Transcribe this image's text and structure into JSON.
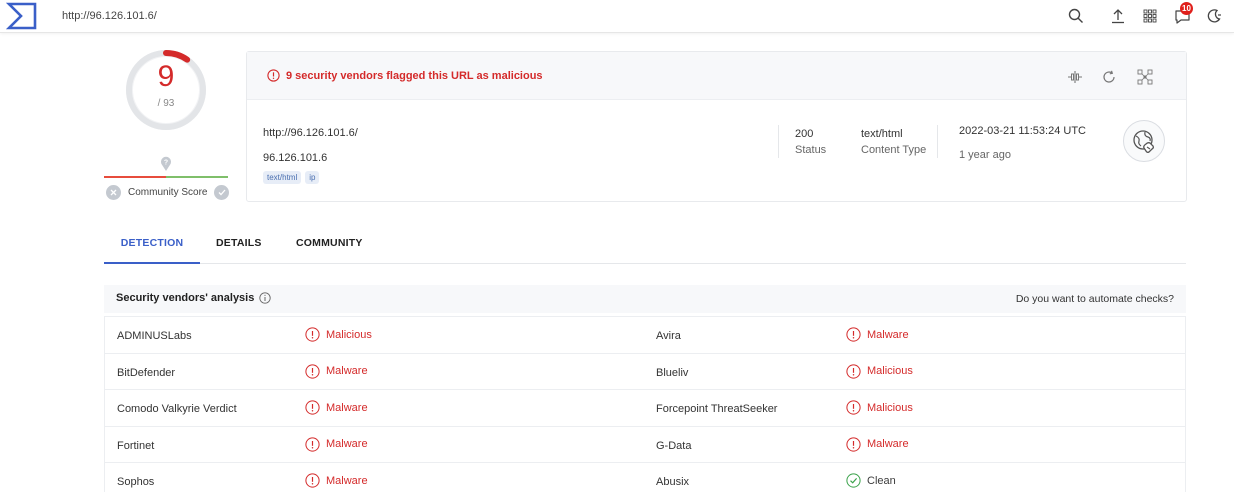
{
  "topbar": {
    "url": "http://96.126.101.6/",
    "icons": [
      "search-icon",
      "upload-icon",
      "apps-grid-icon",
      "notifications-icon",
      "dark-mode-icon"
    ],
    "notification_count": "10"
  },
  "score": {
    "detections": "9",
    "total": "/ 93",
    "fraction_flagged": 0.0968,
    "community_label": "Community Score"
  },
  "summary": {
    "alert": "9 security vendors flagged this URL as malicious",
    "url": "http://96.126.101.6/",
    "host": "96.126.101.6",
    "tags": [
      "text/html",
      "ip"
    ],
    "status_value": "200",
    "status_label": "Status",
    "content_type_value": "text/html",
    "content_type_label": "Content Type",
    "date": "2022-03-21 11:53:24 UTC",
    "ago": "1 year ago"
  },
  "tabs": [
    {
      "label": "DETECTION",
      "active": true
    },
    {
      "label": "DETAILS",
      "active": false
    },
    {
      "label": "COMMUNITY",
      "active": false
    }
  ],
  "vendors": {
    "title": "Security vendors' analysis",
    "automate_link": "Do you want to automate checks?",
    "rows": [
      {
        "left_name": "ADMINUSLabs",
        "left_result": "Malicious",
        "left_state": "bad",
        "right_name": "Avira",
        "right_result": "Malware",
        "right_state": "bad"
      },
      {
        "left_name": "BitDefender",
        "left_result": "Malware",
        "left_state": "bad",
        "right_name": "Blueliv",
        "right_result": "Malicious",
        "right_state": "bad"
      },
      {
        "left_name": "Comodo Valkyrie Verdict",
        "left_result": "Malware",
        "left_state": "bad",
        "right_name": "Forcepoint ThreatSeeker",
        "right_result": "Malicious",
        "right_state": "bad"
      },
      {
        "left_name": "Fortinet",
        "left_result": "Malware",
        "left_state": "bad",
        "right_name": "G-Data",
        "right_result": "Malware",
        "right_state": "bad"
      },
      {
        "left_name": "Sophos",
        "left_result": "Malware",
        "left_state": "bad",
        "right_name": "Abusix",
        "right_result": "Clean",
        "right_state": "ok"
      }
    ]
  },
  "colors": {
    "malicious": "#d42a2a",
    "accent": "#3a5fc8",
    "clean": "#3aa24a",
    "logo": "#3a5fc8"
  }
}
